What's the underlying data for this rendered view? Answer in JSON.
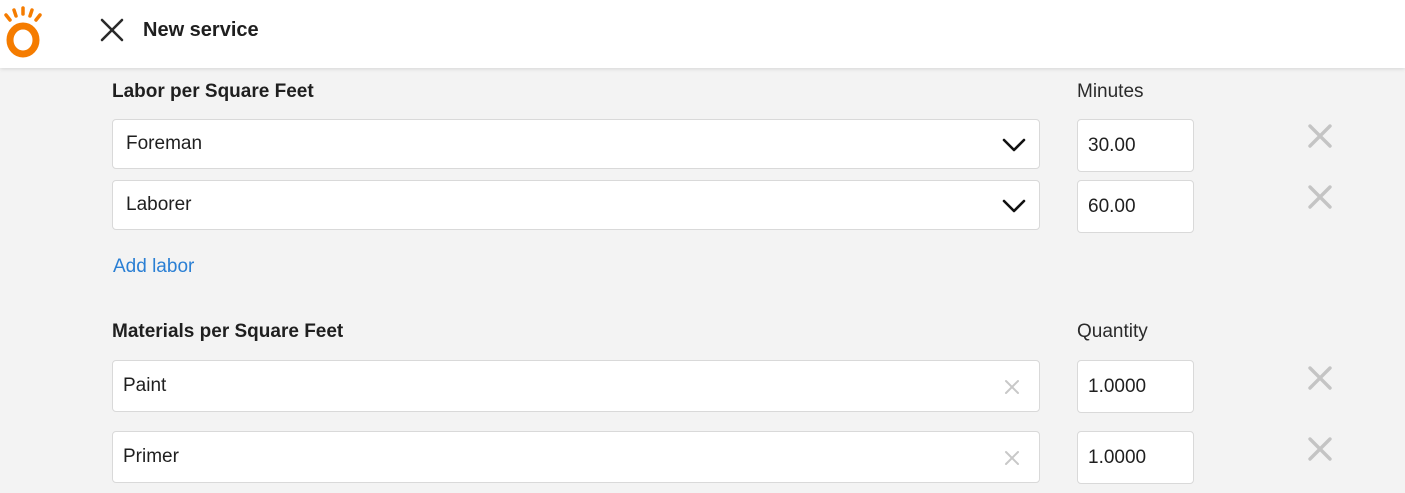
{
  "header": {
    "title": "New service",
    "brand_color": "#f57c00",
    "icons": {
      "logo": "sunburst-logo-icon",
      "close": "close-icon"
    }
  },
  "labor": {
    "section_label": "Labor per Square Feet",
    "column_label": "Minutes",
    "rows": [
      {
        "role": "Foreman",
        "minutes": "30.00"
      },
      {
        "role": "Laborer",
        "minutes": "60.00"
      }
    ],
    "add_label": "Add labor"
  },
  "materials": {
    "section_label": "Materials per Square Feet",
    "column_label": "Quantity",
    "rows": [
      {
        "name": "Paint",
        "quantity": "1.0000"
      },
      {
        "name": "Primer",
        "quantity": "1.0000"
      }
    ]
  },
  "colors": {
    "link": "#2a7fd4",
    "remove_icon": "#c4c4c4",
    "background": "#f3f3f3"
  }
}
